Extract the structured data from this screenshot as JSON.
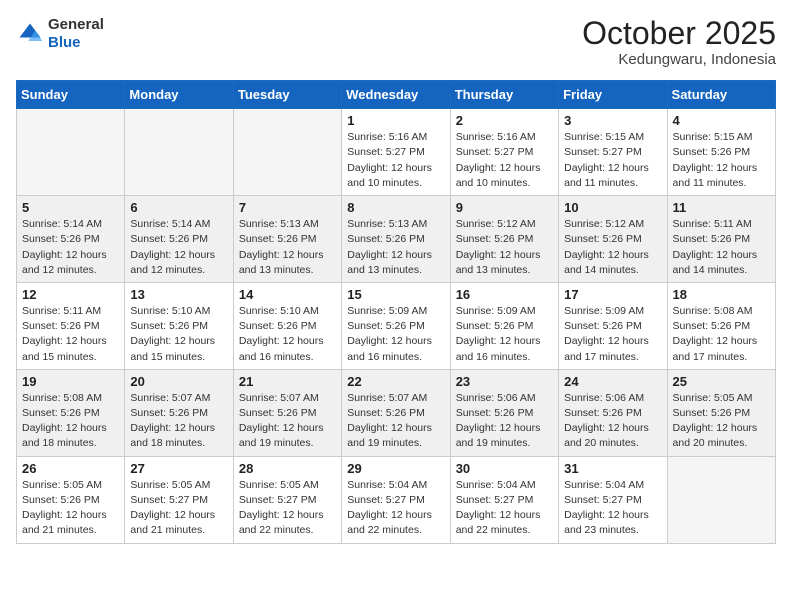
{
  "header": {
    "logo": {
      "general": "General",
      "blue": "Blue"
    },
    "title": "October 2025",
    "location": "Kedungwaru, Indonesia"
  },
  "weekdays": [
    "Sunday",
    "Monday",
    "Tuesday",
    "Wednesday",
    "Thursday",
    "Friday",
    "Saturday"
  ],
  "weeks": [
    [
      {
        "day": "",
        "sunrise": "",
        "sunset": "",
        "daylight": ""
      },
      {
        "day": "",
        "sunrise": "",
        "sunset": "",
        "daylight": ""
      },
      {
        "day": "",
        "sunrise": "",
        "sunset": "",
        "daylight": ""
      },
      {
        "day": "1",
        "sunrise": "Sunrise: 5:16 AM",
        "sunset": "Sunset: 5:27 PM",
        "daylight": "Daylight: 12 hours and 10 minutes."
      },
      {
        "day": "2",
        "sunrise": "Sunrise: 5:16 AM",
        "sunset": "Sunset: 5:27 PM",
        "daylight": "Daylight: 12 hours and 10 minutes."
      },
      {
        "day": "3",
        "sunrise": "Sunrise: 5:15 AM",
        "sunset": "Sunset: 5:27 PM",
        "daylight": "Daylight: 12 hours and 11 minutes."
      },
      {
        "day": "4",
        "sunrise": "Sunrise: 5:15 AM",
        "sunset": "Sunset: 5:26 PM",
        "daylight": "Daylight: 12 hours and 11 minutes."
      }
    ],
    [
      {
        "day": "5",
        "sunrise": "Sunrise: 5:14 AM",
        "sunset": "Sunset: 5:26 PM",
        "daylight": "Daylight: 12 hours and 12 minutes."
      },
      {
        "day": "6",
        "sunrise": "Sunrise: 5:14 AM",
        "sunset": "Sunset: 5:26 PM",
        "daylight": "Daylight: 12 hours and 12 minutes."
      },
      {
        "day": "7",
        "sunrise": "Sunrise: 5:13 AM",
        "sunset": "Sunset: 5:26 PM",
        "daylight": "Daylight: 12 hours and 13 minutes."
      },
      {
        "day": "8",
        "sunrise": "Sunrise: 5:13 AM",
        "sunset": "Sunset: 5:26 PM",
        "daylight": "Daylight: 12 hours and 13 minutes."
      },
      {
        "day": "9",
        "sunrise": "Sunrise: 5:12 AM",
        "sunset": "Sunset: 5:26 PM",
        "daylight": "Daylight: 12 hours and 13 minutes."
      },
      {
        "day": "10",
        "sunrise": "Sunrise: 5:12 AM",
        "sunset": "Sunset: 5:26 PM",
        "daylight": "Daylight: 12 hours and 14 minutes."
      },
      {
        "day": "11",
        "sunrise": "Sunrise: 5:11 AM",
        "sunset": "Sunset: 5:26 PM",
        "daylight": "Daylight: 12 hours and 14 minutes."
      }
    ],
    [
      {
        "day": "12",
        "sunrise": "Sunrise: 5:11 AM",
        "sunset": "Sunset: 5:26 PM",
        "daylight": "Daylight: 12 hours and 15 minutes."
      },
      {
        "day": "13",
        "sunrise": "Sunrise: 5:10 AM",
        "sunset": "Sunset: 5:26 PM",
        "daylight": "Daylight: 12 hours and 15 minutes."
      },
      {
        "day": "14",
        "sunrise": "Sunrise: 5:10 AM",
        "sunset": "Sunset: 5:26 PM",
        "daylight": "Daylight: 12 hours and 16 minutes."
      },
      {
        "day": "15",
        "sunrise": "Sunrise: 5:09 AM",
        "sunset": "Sunset: 5:26 PM",
        "daylight": "Daylight: 12 hours and 16 minutes."
      },
      {
        "day": "16",
        "sunrise": "Sunrise: 5:09 AM",
        "sunset": "Sunset: 5:26 PM",
        "daylight": "Daylight: 12 hours and 16 minutes."
      },
      {
        "day": "17",
        "sunrise": "Sunrise: 5:09 AM",
        "sunset": "Sunset: 5:26 PM",
        "daylight": "Daylight: 12 hours and 17 minutes."
      },
      {
        "day": "18",
        "sunrise": "Sunrise: 5:08 AM",
        "sunset": "Sunset: 5:26 PM",
        "daylight": "Daylight: 12 hours and 17 minutes."
      }
    ],
    [
      {
        "day": "19",
        "sunrise": "Sunrise: 5:08 AM",
        "sunset": "Sunset: 5:26 PM",
        "daylight": "Daylight: 12 hours and 18 minutes."
      },
      {
        "day": "20",
        "sunrise": "Sunrise: 5:07 AM",
        "sunset": "Sunset: 5:26 PM",
        "daylight": "Daylight: 12 hours and 18 minutes."
      },
      {
        "day": "21",
        "sunrise": "Sunrise: 5:07 AM",
        "sunset": "Sunset: 5:26 PM",
        "daylight": "Daylight: 12 hours and 19 minutes."
      },
      {
        "day": "22",
        "sunrise": "Sunrise: 5:07 AM",
        "sunset": "Sunset: 5:26 PM",
        "daylight": "Daylight: 12 hours and 19 minutes."
      },
      {
        "day": "23",
        "sunrise": "Sunrise: 5:06 AM",
        "sunset": "Sunset: 5:26 PM",
        "daylight": "Daylight: 12 hours and 19 minutes."
      },
      {
        "day": "24",
        "sunrise": "Sunrise: 5:06 AM",
        "sunset": "Sunset: 5:26 PM",
        "daylight": "Daylight: 12 hours and 20 minutes."
      },
      {
        "day": "25",
        "sunrise": "Sunrise: 5:05 AM",
        "sunset": "Sunset: 5:26 PM",
        "daylight": "Daylight: 12 hours and 20 minutes."
      }
    ],
    [
      {
        "day": "26",
        "sunrise": "Sunrise: 5:05 AM",
        "sunset": "Sunset: 5:26 PM",
        "daylight": "Daylight: 12 hours and 21 minutes."
      },
      {
        "day": "27",
        "sunrise": "Sunrise: 5:05 AM",
        "sunset": "Sunset: 5:27 PM",
        "daylight": "Daylight: 12 hours and 21 minutes."
      },
      {
        "day": "28",
        "sunrise": "Sunrise: 5:05 AM",
        "sunset": "Sunset: 5:27 PM",
        "daylight": "Daylight: 12 hours and 22 minutes."
      },
      {
        "day": "29",
        "sunrise": "Sunrise: 5:04 AM",
        "sunset": "Sunset: 5:27 PM",
        "daylight": "Daylight: 12 hours and 22 minutes."
      },
      {
        "day": "30",
        "sunrise": "Sunrise: 5:04 AM",
        "sunset": "Sunset: 5:27 PM",
        "daylight": "Daylight: 12 hours and 22 minutes."
      },
      {
        "day": "31",
        "sunrise": "Sunrise: 5:04 AM",
        "sunset": "Sunset: 5:27 PM",
        "daylight": "Daylight: 12 hours and 23 minutes."
      },
      {
        "day": "",
        "sunrise": "",
        "sunset": "",
        "daylight": ""
      }
    ]
  ]
}
